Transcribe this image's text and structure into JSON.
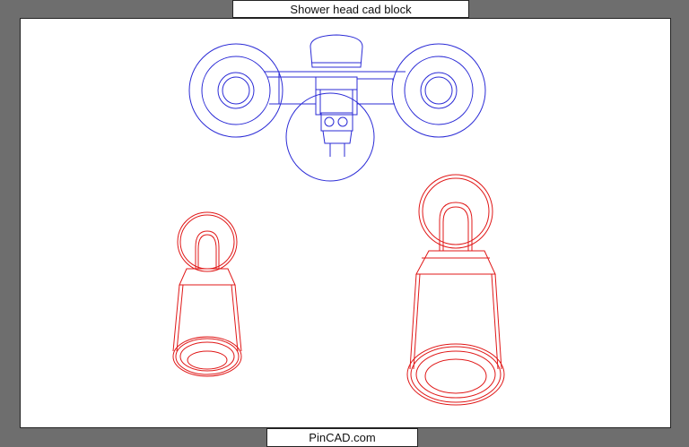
{
  "header": {
    "title": "Shower head cad block"
  },
  "footer": {
    "watermark": "PinCAD.com"
  },
  "colors": {
    "plan_view": "#2b2bd6",
    "elevation_views": "#e01818",
    "frame": "#6e6e6e",
    "paper": "#ffffff"
  }
}
